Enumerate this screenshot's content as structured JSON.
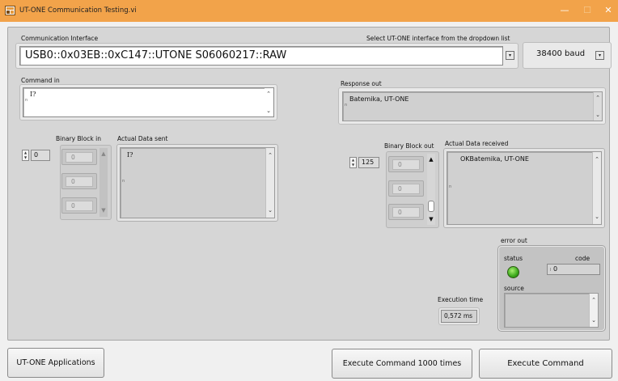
{
  "window": {
    "title": "UT-ONE Communication Testing.vi",
    "icon_text": "LabVIEW",
    "minimize_glyph": "—",
    "maximize_glyph": "☐",
    "close_glyph": "✕"
  },
  "communication": {
    "label": "Communication Interface",
    "hint": "Select UT-ONE interface from the dropdown list",
    "resource_value": "USB0::0x03EB::0xC147::UTONE S06060217::RAW",
    "baud_value": "38400 baud"
  },
  "command_in": {
    "label": "Command in",
    "value": "I?"
  },
  "response_out": {
    "label": "Response out",
    "value": "Batemika, UT-ONE"
  },
  "binary_block_in": {
    "label": "Binary Block in",
    "index": "0",
    "values": [
      "0",
      "0",
      "0"
    ]
  },
  "actual_data_sent": {
    "label": "Actual Data sent",
    "value": "I?"
  },
  "binary_block_out": {
    "label": "Binary Block out",
    "index": "125",
    "values": [
      "0",
      "0",
      "0"
    ]
  },
  "actual_data_received": {
    "label": "Actual Data received",
    "value": "OKBatemika, UT-ONE"
  },
  "error_out": {
    "label": "error out",
    "status_label": "status",
    "code_label": "code",
    "code_value": "0",
    "source_label": "source",
    "source_value": "",
    "status_color": "#3aa81a"
  },
  "execution_time": {
    "label": "Execution time",
    "value": "0,572 ms"
  },
  "buttons": {
    "applications": "UT-ONE Applications",
    "execute_1000": "Execute Command 1000 times",
    "execute": "Execute Command"
  },
  "colors": {
    "titlebar": "#f2a34a",
    "panel": "#d6d6d6"
  }
}
